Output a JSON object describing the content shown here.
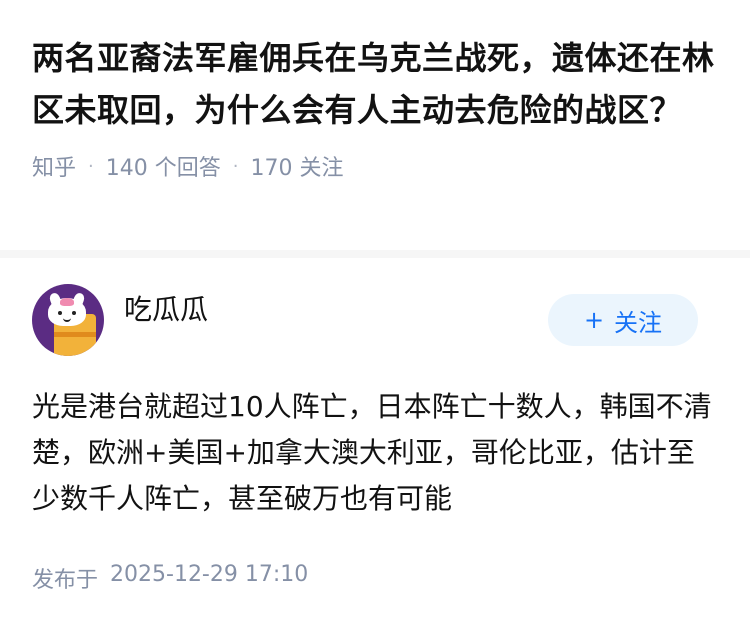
{
  "question": {
    "title": "两名亚裔法军雇佣兵在乌克兰战死，遗体还在林区未取回，为什么会有人主动去危险的战区？",
    "source": "知乎",
    "answer_count": "140",
    "answer_label": "个回答",
    "follower_count": "170",
    "follower_label": "关注"
  },
  "answer": {
    "author": {
      "name": "吃瓜瓜",
      "avatar_icon": "cartoon-cat-cup-avatar"
    },
    "follow_button": {
      "icon": "plus-icon",
      "label": "关注"
    },
    "content": "光是港台就超过10人阵亡，日本阵亡十数人，韩国不清楚，欧洲+美国+加拿大澳大利亚，哥伦比亚，估计至少数千人阵亡，甚至破万也有可能",
    "publish_label": "发布于",
    "publish_time": "2025-12-29 17:10"
  },
  "colors": {
    "accent": "#1772f6",
    "meta_gray": "#8590a6",
    "follow_bg": "#ebf5fd"
  }
}
